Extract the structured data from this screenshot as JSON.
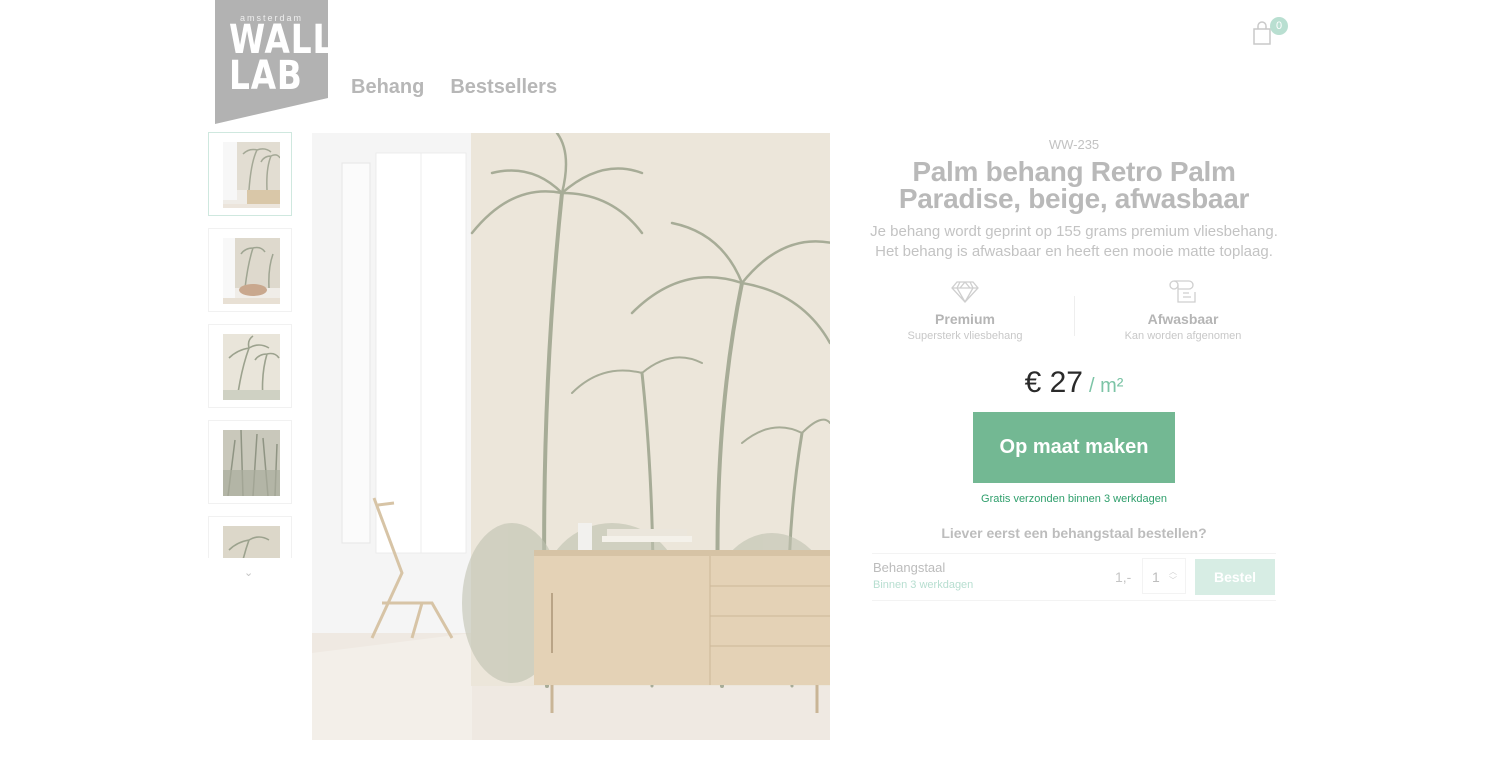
{
  "brand": {
    "small": "amsterdam",
    "line1": "WALL",
    "line2": "LAB"
  },
  "nav": {
    "items": [
      "Behang",
      "Bestsellers"
    ]
  },
  "cart": {
    "count": "0",
    "icon": "shopping-bag-icon"
  },
  "thumbnails": {
    "count": 5,
    "scroll_icon": "chevron-down-icon",
    "scroll_glyph": "⌄"
  },
  "product": {
    "sku": "WW-235",
    "title_line1": "Palm behang Retro Palm",
    "title_line2": "Paradise, beige, afwasbaar",
    "description": "Je behang wordt geprint op 155 grams premium vliesbehang. Het behang is afwasbaar en heeft een mooie matte toplaag."
  },
  "features": [
    {
      "icon": "diamond-icon",
      "title": "Premium",
      "subtitle": "Supersterk vliesbehang"
    },
    {
      "icon": "paper-roll-icon",
      "title": "Afwasbaar",
      "subtitle": "Kan worden afgenomen"
    }
  ],
  "price": {
    "amount": "€ 27",
    "unit": "/ m²"
  },
  "cta": {
    "label": "Op maat maken"
  },
  "shipping_note": "Gratis verzonden binnen 3 werkdagen",
  "sample": {
    "question": "Liever eerst een behangstaal bestellen?",
    "name": "Behangstaal",
    "delivery": "Binnen 3 werkdagen",
    "price": "1,-",
    "quantity": "1",
    "button": "Bestel"
  },
  "colors": {
    "accent": "#73b893",
    "accent_light": "#d7ede4",
    "logo_bg": "#b2b2b2",
    "ship_text": "#2f9f6c"
  }
}
